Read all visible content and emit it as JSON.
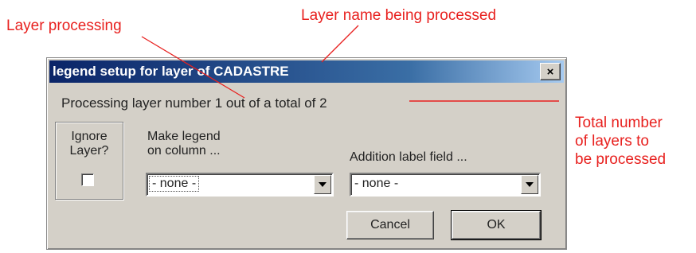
{
  "annotations": {
    "layer_processing": "Layer processing",
    "layer_name": "Layer name being processed",
    "total_layers": [
      "Total number",
      "of layers to",
      "be processed"
    ],
    "color": "#e8211f"
  },
  "dialog": {
    "title": "legend setup for layer of CADASTRE",
    "close_glyph": "×",
    "process_text": "Processing layer number 1 out of a total of 2",
    "ignore_label": "Ignore Layer?",
    "ignore_checked": false,
    "legend_column_label_line1": "Make legend",
    "legend_column_label_line2": "on column ...",
    "legend_column_value": "- none -",
    "addition_label": "Addition label field ...",
    "addition_value": "- none -",
    "cancel_label": "Cancel",
    "ok_label": "OK",
    "icons": {
      "close": "close-icon",
      "dropdown": "chevron-down-icon"
    }
  }
}
